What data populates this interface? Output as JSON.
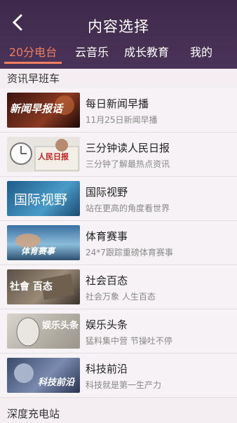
{
  "header": {
    "title": "内容选择",
    "tabs": [
      "20分电台",
      "云音乐",
      "成长教育",
      "我的"
    ],
    "active_tab": 0
  },
  "sections": {
    "first": "资讯早班车",
    "second": "深度充电站"
  },
  "items": [
    {
      "title": "每日新闻早播",
      "subtitle": "11月25日新闻早播",
      "thumb_label": "新闻早报话"
    },
    {
      "title": "三分钟读人民日报",
      "subtitle": "三分钟了解最热点资讯",
      "thumb_label": "人民日报"
    },
    {
      "title": "国际视野",
      "subtitle": "站在更高的角度看世界",
      "thumb_label": "国际视野"
    },
    {
      "title": "体育赛事",
      "subtitle": "24*7跟踪重磅体育赛事",
      "thumb_label": "体育赛事"
    },
    {
      "title": "社会百态",
      "subtitle": "社会万象 人生百态",
      "thumb_label": "社會 百态"
    },
    {
      "title": "娱乐头条",
      "subtitle": "猛料集中营 节操吐不停",
      "thumb_label": "娱乐头条"
    },
    {
      "title": "科技前沿",
      "subtitle": "科技就是第一生产力",
      "thumb_label": "科技前沿"
    }
  ],
  "colors": {
    "accent": "#f07f62",
    "header": "#43304f"
  }
}
